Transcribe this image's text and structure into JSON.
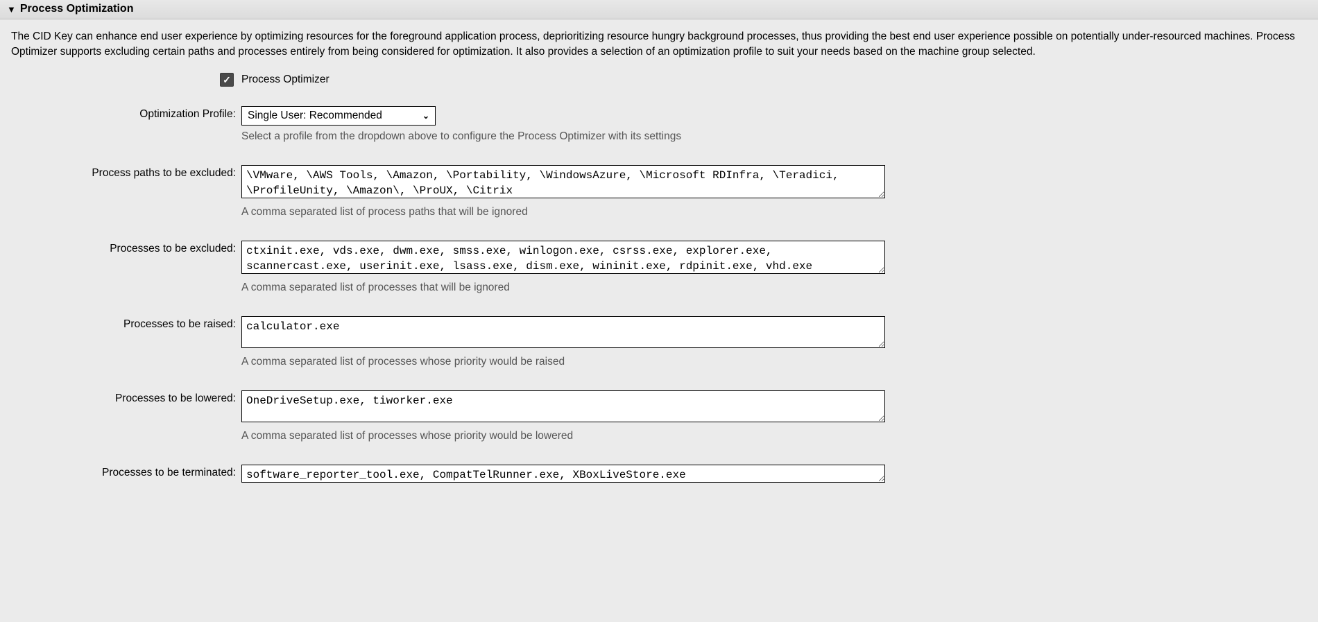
{
  "header": {
    "title": "Process Optimization"
  },
  "description": "The CID Key can enhance end user experience by optimizing resources for the foreground application process, deprioritizing resource hungry background processes, thus providing the best end user experience possible on potentially under-resourced machines. Process Optimizer supports excluding certain paths and processes entirely from being considered for optimization. It also provides a selection of an optimization profile to suit your needs based on the machine group selected.",
  "checkbox": {
    "label": "Process Optimizer",
    "checked": true
  },
  "profile": {
    "label": "Optimization Profile:",
    "value": "Single User: Recommended",
    "hint": "Select a profile from the dropdown above to configure the Process Optimizer with its settings"
  },
  "pathsExcluded": {
    "label": "Process paths to be excluded:",
    "value": "\\VMware, \\AWS Tools, \\Amazon, \\Portability, \\WindowsAzure, \\Microsoft RDInfra, \\Teradici, \\ProfileUnity, \\Amazon\\, \\ProUX, \\Citrix",
    "hint": "A comma separated list of process paths that will be ignored"
  },
  "procsExcluded": {
    "label": "Processes to be excluded:",
    "value": "ctxinit.exe, vds.exe, dwm.exe, smss.exe, winlogon.exe, csrss.exe, explorer.exe, scannercast.exe, userinit.exe, lsass.exe, dism.exe, wininit.exe, rdpinit.exe, vhd.exe",
    "hint": "A comma separated list of processes that will be ignored"
  },
  "procsRaised": {
    "label": "Processes to be raised:",
    "value": "calculator.exe",
    "hint": "A comma separated list of processes whose priority would be raised"
  },
  "procsLowered": {
    "label": "Processes to be lowered:",
    "value": "OneDriveSetup.exe, tiworker.exe",
    "hint": "A comma separated list of processes whose priority would be lowered"
  },
  "procsTerminated": {
    "label": "Processes to be terminated:",
    "value": "software_reporter_tool.exe, CompatTelRunner.exe, XBoxLiveStore.exe"
  }
}
